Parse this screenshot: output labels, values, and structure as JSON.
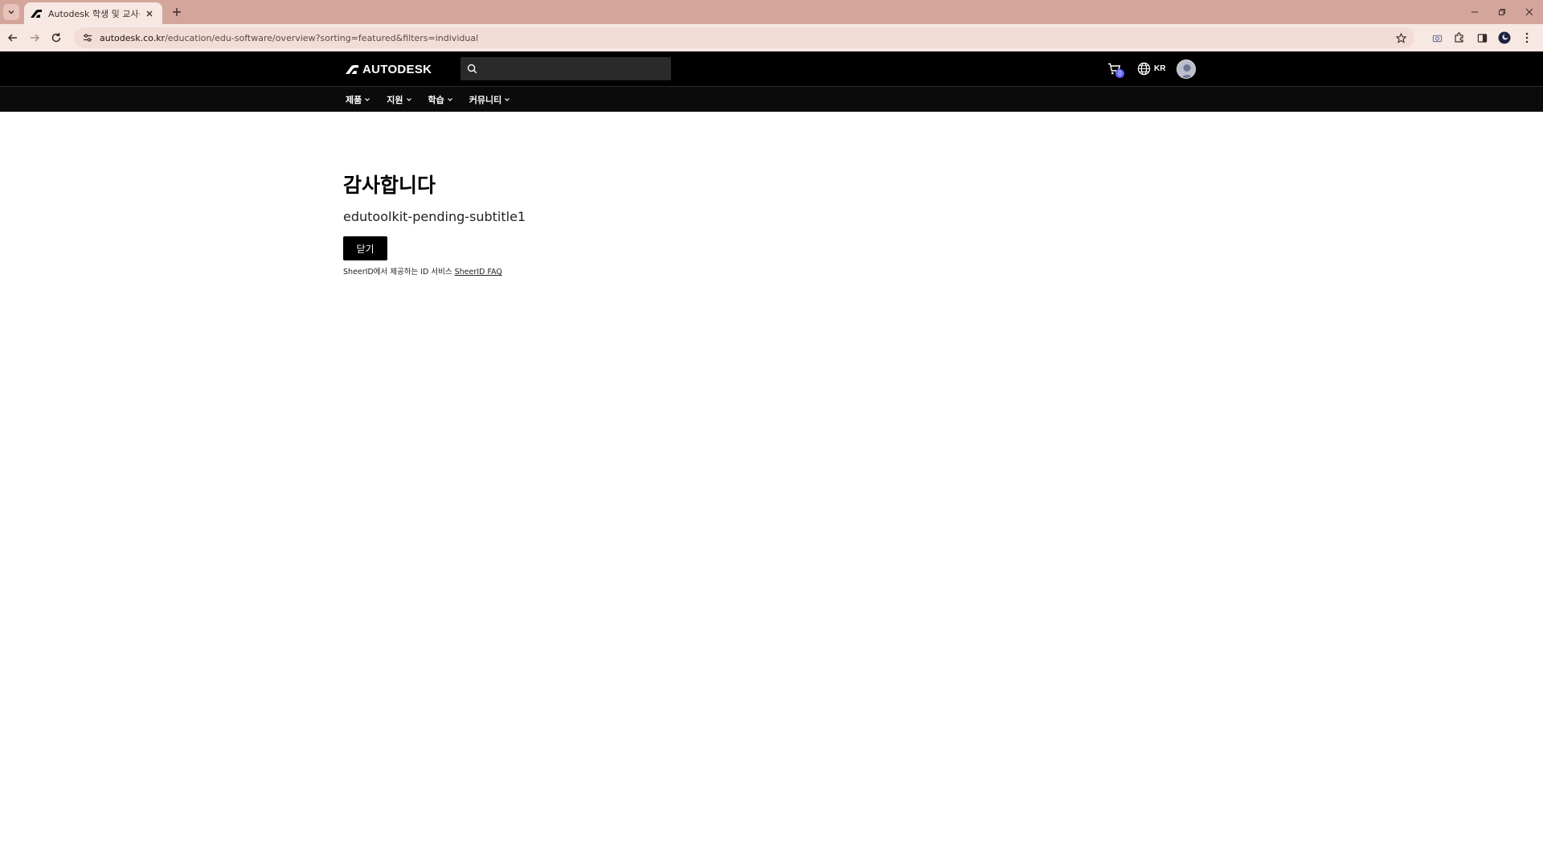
{
  "browser": {
    "tab_title": "Autodesk 학생 및 교사용 액세",
    "url_domain": "autodesk.co.kr",
    "url_path": "/education/edu-software/overview?sorting=featured&filters=individual"
  },
  "header": {
    "brand": "AUTODESK",
    "search": {
      "value": "",
      "placeholder": ""
    },
    "cart_count": "0",
    "locale": "KR"
  },
  "nav": {
    "items": [
      {
        "label": "제품"
      },
      {
        "label": "지원"
      },
      {
        "label": "학습"
      },
      {
        "label": "커뮤니티"
      }
    ]
  },
  "main": {
    "title": "감사합니다",
    "subtitle": "edutoolkit-pending-subtitle1",
    "close_label": "닫기",
    "footnote_text": "SheerID에서 제공하는 ID 서비스 ",
    "footnote_link": "SheerID FAQ"
  },
  "colors": {
    "tabbar": "#d4a59b",
    "toolbar": "#f7e8e4",
    "header_bg": "#000000",
    "cart_badge": "#5f60ff"
  }
}
